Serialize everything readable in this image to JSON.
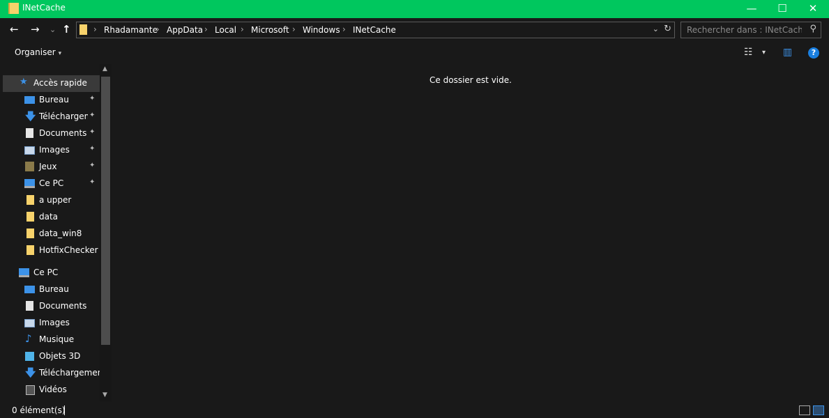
{
  "window": {
    "title": "INetCache",
    "minimize_glyph": "—",
    "maximize_glyph": "☐",
    "close_glyph": "✕"
  },
  "navigation": {
    "back_glyph": "←",
    "forward_glyph": "→",
    "recent_glyph": "⌄",
    "up_glyph": "↑"
  },
  "address": {
    "breadcrumbs": [
      "Rhadamante",
      "AppData",
      "Local",
      "Microsoft",
      "Windows",
      "INetCache"
    ],
    "separator": "›",
    "dropdown_glyph": "⌄",
    "refresh_glyph": "↻"
  },
  "search": {
    "placeholder": "Rechercher dans : INetCache",
    "icon_glyph": "⚲"
  },
  "commandbar": {
    "organiser_label": "Organiser",
    "organiser_caret": "▾",
    "view_glyph": "☷",
    "view_caret": "▾",
    "pane_glyph": "▥",
    "help_glyph": "?"
  },
  "navpane": {
    "quick_access_label": "Accès rapide",
    "quick_access_items": [
      {
        "label": "Bureau",
        "icon": "desktop-icon",
        "pinned": true
      },
      {
        "label": "Téléchargements",
        "icon": "download-icon",
        "pinned": true
      },
      {
        "label": "Documents",
        "icon": "documents-icon",
        "pinned": true
      },
      {
        "label": "Images",
        "icon": "pictures-icon",
        "pinned": true
      },
      {
        "label": "Jeux",
        "icon": "games-icon",
        "pinned": true
      },
      {
        "label": "Ce PC",
        "icon": "pc-icon",
        "pinned": true
      },
      {
        "label": "a upper",
        "icon": "folder-icon",
        "pinned": false
      },
      {
        "label": "data",
        "icon": "folder-icon",
        "pinned": false
      },
      {
        "label": "data_win8",
        "icon": "folder-icon",
        "pinned": false
      },
      {
        "label": "HotfixChecker",
        "icon": "folder-icon",
        "pinned": false
      }
    ],
    "this_pc_label": "Ce PC",
    "this_pc_items": [
      {
        "label": "Bureau",
        "icon": "desktop-icon"
      },
      {
        "label": "Documents",
        "icon": "documents-icon"
      },
      {
        "label": "Images",
        "icon": "pictures-icon"
      },
      {
        "label": "Musique",
        "icon": "music-icon"
      },
      {
        "label": "Objets 3D",
        "icon": "objects-3d-icon"
      },
      {
        "label": "Téléchargements",
        "icon": "download-icon"
      },
      {
        "label": "Vidéos",
        "icon": "videos-icon"
      }
    ],
    "pin_glyph": "📌",
    "scroll_up_glyph": "︿",
    "scroll_down_glyph": "﹀"
  },
  "content": {
    "empty_message": "Ce dossier est vide."
  },
  "status": {
    "item_count": "0 élément(s)"
  },
  "colors": {
    "titlebar": "#00c75e",
    "background": "#191919",
    "accent": "#3c92e8",
    "folder": "#f7d26b"
  }
}
